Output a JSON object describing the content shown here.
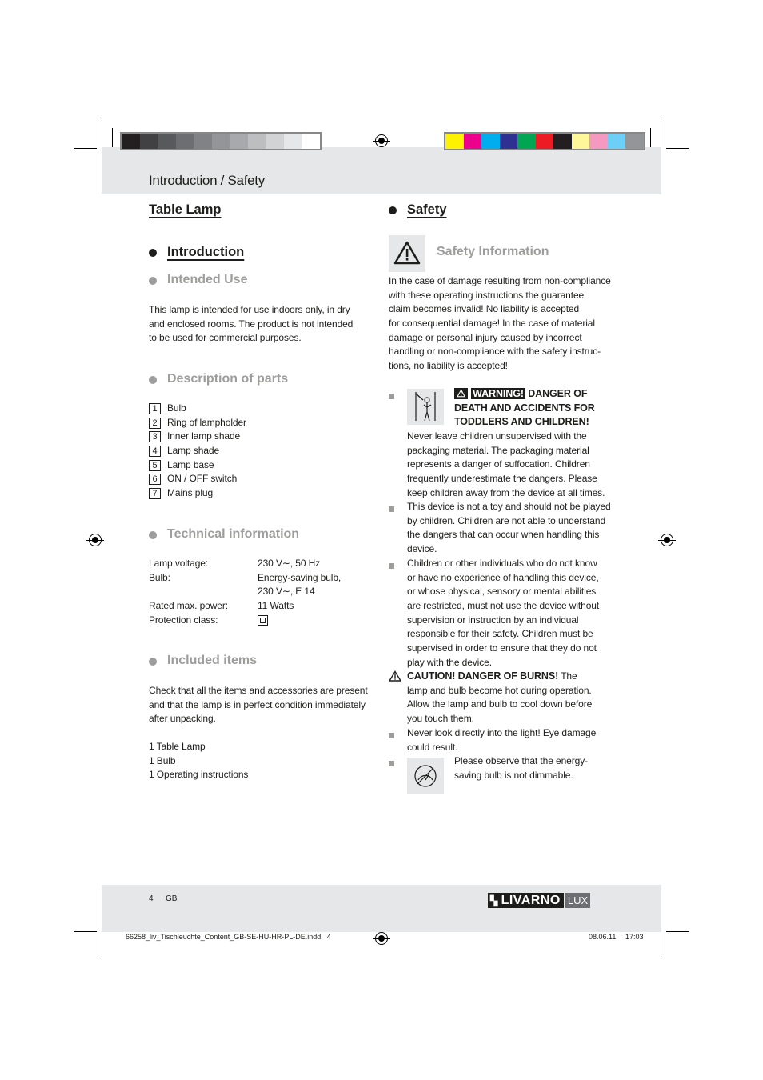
{
  "header": {
    "title": "Introduction / Safety"
  },
  "color_bars": {
    "gray": [
      "#231f20",
      "#414042",
      "#58595b",
      "#6d6e71",
      "#808285",
      "#939598",
      "#a7a9ac",
      "#bcbec0",
      "#d1d3d4",
      "#e6e7e8",
      "#ffffff"
    ],
    "color": [
      "#fff200",
      "#ec008c",
      "#00aeef",
      "#2e3192",
      "#00a651",
      "#ed1c24",
      "#231f20",
      "#fff799",
      "#f49ac1",
      "#6dcff6",
      "#939598"
    ]
  },
  "left": {
    "product_title": "Table Lamp",
    "introduction": "Introduction",
    "intended_use": {
      "heading": "Intended Use",
      "lines": [
        "This lamp is intended for use indoors only, in dry",
        "and enclosed rooms. The product is not intended",
        "to be used for commercial purposes."
      ]
    },
    "parts": {
      "heading": "Description of parts",
      "items": [
        {
          "n": "1",
          "label": "Bulb"
        },
        {
          "n": "2",
          "label": "Ring of lampholder"
        },
        {
          "n": "3",
          "label": "Inner lamp shade"
        },
        {
          "n": "4",
          "label": "Lamp shade"
        },
        {
          "n": "5",
          "label": "Lamp base"
        },
        {
          "n": "6",
          "label": "ON / OFF switch"
        },
        {
          "n": "7",
          "label": "Mains plug"
        }
      ]
    },
    "technical": {
      "heading": "Technical information",
      "rows": [
        {
          "label": "Lamp voltage:",
          "value": "230 V∼, 50 Hz"
        },
        {
          "label": "Bulb:",
          "value": "Energy-saving bulb,"
        },
        {
          "label": "",
          "value": "230 V∼, E 14"
        },
        {
          "label": "Rated max. power:",
          "value": "11 Watts"
        },
        {
          "label": "Protection class:",
          "value": ""
        }
      ]
    },
    "included": {
      "heading": "Included items",
      "lines": [
        "Check that all the items and accessories are present",
        "and that the lamp is in perfect condition immediately",
        "after unpacking."
      ],
      "items": [
        "1 Table Lamp",
        "1 Bulb",
        "1 Operating instructions"
      ]
    }
  },
  "right": {
    "safety": "Safety",
    "safety_information": {
      "heading": "Safety Information",
      "lines": [
        "In the case of damage resulting from non-compliance",
        "with these operating instructions the guarantee",
        "claim becomes invalid! No liability is accepted",
        "for consequential damage! In the case of material",
        "damage or personal injury caused by incorrect",
        "handling or non-compliance with the safety instruc-",
        "tions, no liability is accepted!"
      ]
    },
    "warning": {
      "badge": "WARNING!",
      "heading_lines": [
        "DANGER OF",
        "DEATH AND ACCIDENTS FOR",
        "TODDLERS AND CHILDREN!"
      ],
      "lines": [
        "Never leave children unsupervised with the",
        "packaging material. The packaging material",
        "represents a danger of suffocation. Children",
        "frequently underestimate the dangers. Please",
        "keep children away from the device at all times."
      ]
    },
    "bullet2": [
      "This device is not a toy and should not be played",
      "by children. Children are not able to understand",
      "the dangers that can occur when handling this",
      "device."
    ],
    "bullet3": [
      "Children or other individuals who do not know",
      "or have no experience of handling this device,",
      "or whose physical, sensory or mental abilities",
      "are restricted, must not use the device without",
      "supervision or instruction by an individual",
      "responsible for their safety. Children must be",
      "supervised in order to ensure that they do not",
      "play with the device."
    ],
    "caution": {
      "bold": "CAUTION! DANGER OF BURNS!",
      "first_rest": " The",
      "lines": [
        "lamp and bulb become hot during operation.",
        "Allow the lamp and bulb to cool down before",
        "you touch them."
      ]
    },
    "bullet4": [
      "Never look directly into the light! Eye damage",
      "could result."
    ],
    "bullet5": [
      "Please observe that the energy-",
      "saving bulb is not dimmable."
    ]
  },
  "footer": {
    "page": "4",
    "lang": "GB",
    "brand": "LIVARNO",
    "brand_suffix": "LUX",
    "file": "66258_liv_Tischleuchte_Content_GB-SE-HU-HR-PL-DE.indd   4",
    "date": "08.06.11",
    "time": "17:03"
  }
}
